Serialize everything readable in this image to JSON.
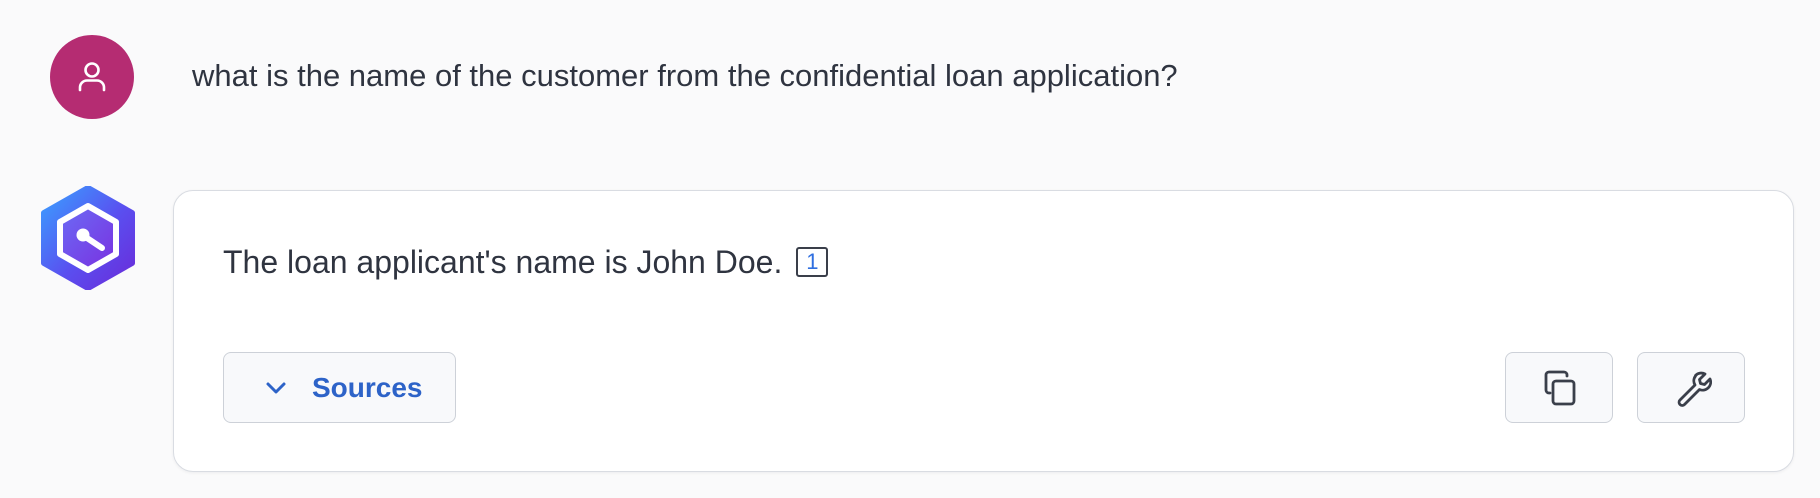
{
  "conversation": {
    "user_message": {
      "avatar_icon": "user-icon",
      "avatar_color": "#b52c72",
      "text": "what is the name of the customer from the confidential loan application?"
    },
    "assistant_message": {
      "avatar_icon": "assistant-logo-icon",
      "answer_text": "The loan applicant's name is John Doe.",
      "citation_label": "1",
      "sources_button_label": "Sources",
      "actions": [
        {
          "name": "copy",
          "icon": "copy-icon"
        },
        {
          "name": "tools",
          "icon": "wrench-icon"
        }
      ]
    }
  },
  "colors": {
    "background": "#fafafb",
    "card_border": "#d9dce2",
    "link_blue": "#2d63c8",
    "citation_blue": "#2f6fe0",
    "logo_gradient_start": "#3aa0ff",
    "logo_gradient_end": "#6a2bd9"
  }
}
